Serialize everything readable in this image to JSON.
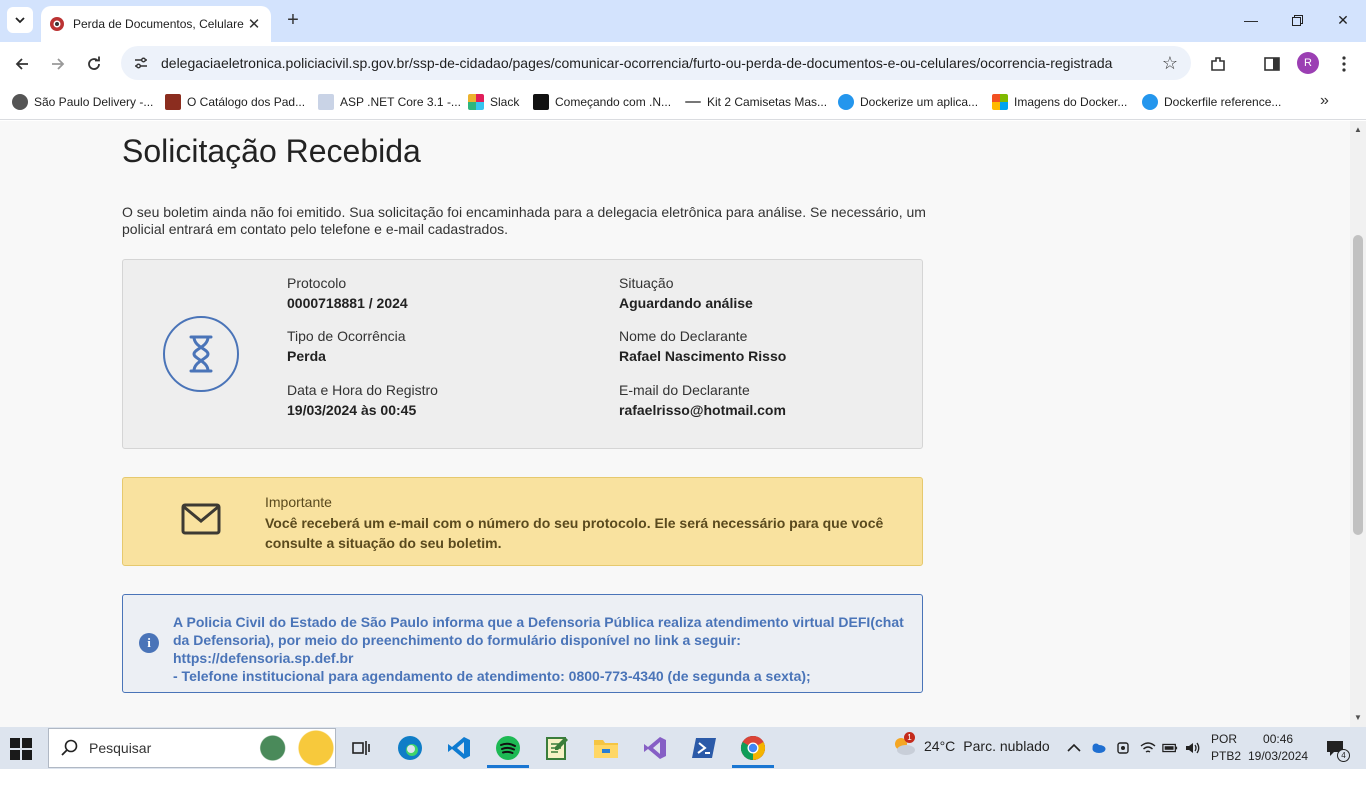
{
  "browser": {
    "tab_title": "Perda de Documentos, Celulare",
    "url": "delegaciaeletronica.policiacivil.sp.gov.br/ssp-de-cidadao/pages/comunicar-ocorrencia/furto-ou-perda-de-documentos-e-ou-celulares/ocorrencia-registrada",
    "profile_initial": "R",
    "bookmarks": [
      "São Paulo Delivery -...",
      "O Catálogo dos Pad...",
      "ASP .NET Core 3.1 -...",
      "Slack",
      "Começando com .N...",
      "Kit 2 Camisetas Mas...",
      "Dockerize um aplica...",
      "Imagens do Docker...",
      "Dockerfile reference..."
    ]
  },
  "page": {
    "title": "Solicitação Recebida",
    "intro": "O seu boletim ainda não foi emitido. Sua solicitação foi encaminhada para a delegacia eletrônica para análise. Se necessário, um policial entrará em contato pelo telefone e e-mail cadastrados.",
    "details": {
      "protocolo_label": "Protocolo",
      "protocolo_value": "0000718881 / 2024",
      "situacao_label": "Situação",
      "situacao_value": "Aguardando análise",
      "tipo_label": "Tipo de Ocorrência",
      "tipo_value": "Perda",
      "declarante_label": "Nome do Declarante",
      "declarante_value": "Rafael Nascimento Risso",
      "data_label": "Data e Hora do Registro",
      "data_value": "19/03/2024 às 00:45",
      "email_label": "E-mail do Declarante",
      "email_value": "rafaelrisso@hotmail.com"
    },
    "important": {
      "title": "Importante",
      "text": "Você receberá um e-mail com o número do seu protocolo. Ele será necessário para que você consulte a situação do seu boletim."
    },
    "info": {
      "line1": "A Policia Civil do Estado de São Paulo informa que a Defensoria Pública realiza atendimento virtual DEFI(chat da Defensoria), por meio do preenchimento do formulário disponível no link a seguir:",
      "link": "https://defensoria.sp.def.br",
      "line2": "- Telefone institucional para agendamento de atendimento: 0800-773-4340 (de segunda a sexta);"
    }
  },
  "taskbar": {
    "search_placeholder": "Pesquisar",
    "weather_temp": "24°C",
    "weather_desc": "Parc. nublado",
    "weather_badge": "1",
    "lang_1": "POR",
    "lang_2": "PTB2",
    "time": "00:46",
    "date": "19/03/2024",
    "notif_count": "4"
  },
  "colors": {
    "accent_blue": "#4a74b8",
    "warning_bg": "#f9e29f",
    "chrome_tabstrip": "#d3e3fd"
  }
}
